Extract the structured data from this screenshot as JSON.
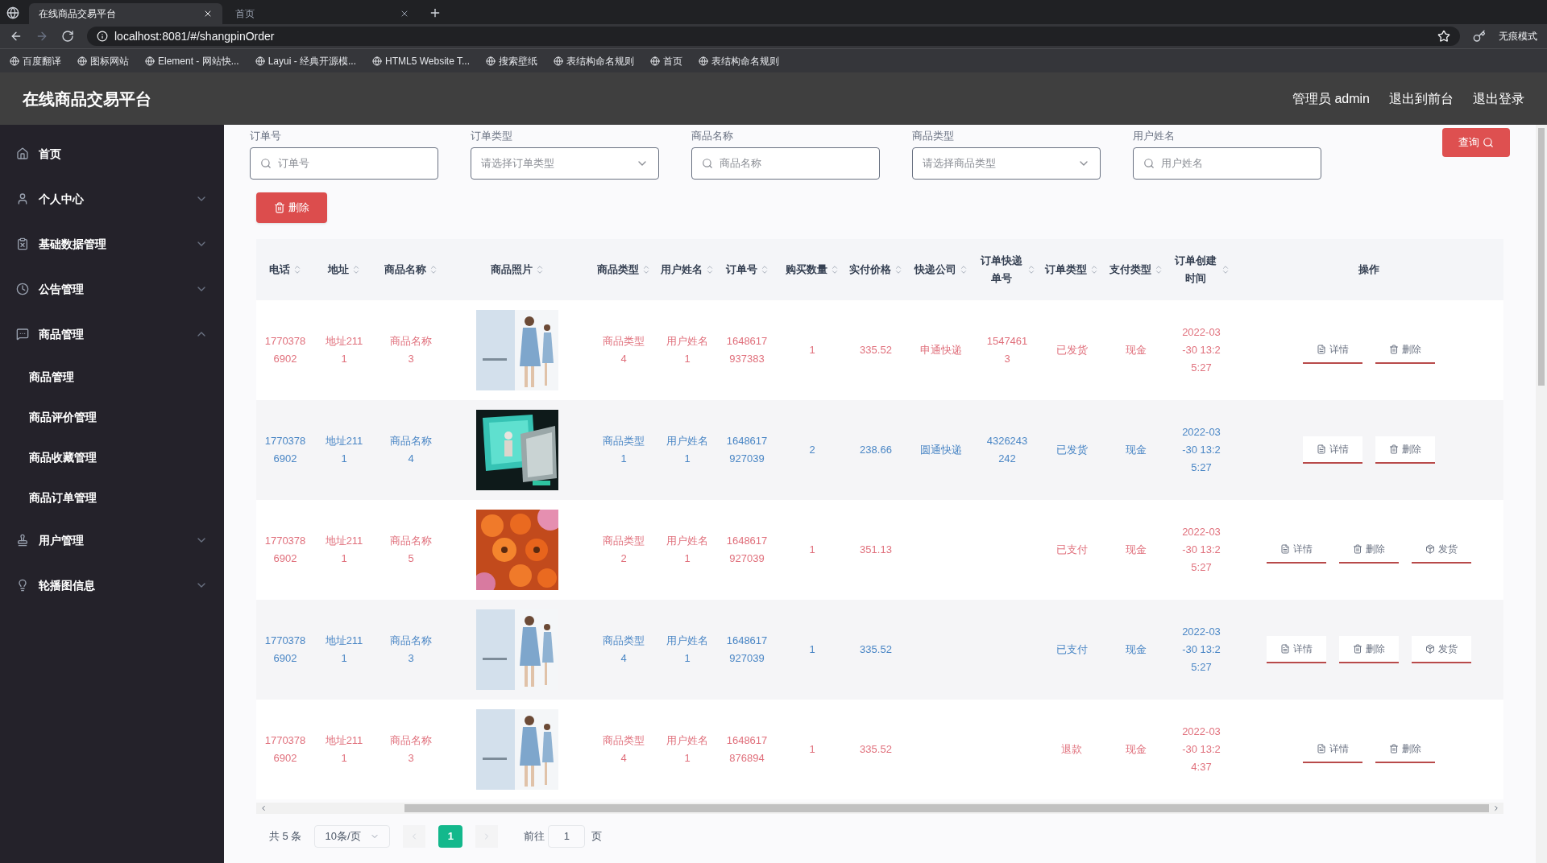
{
  "browser": {
    "tabs": [
      {
        "title": "在线商品交易平台",
        "selected": true
      },
      {
        "title": "首页",
        "selected": false
      }
    ],
    "address": "localhost:8081/#/shangpinOrder",
    "profile": "无痕模式",
    "bookmarks": [
      "百度翻译",
      "图标网站",
      "Element - 网站快...",
      "Layui - 经典开源模...",
      "HTML5 Website T...",
      "搜索壁纸",
      "表结构命名规则",
      "首页",
      "表结构命名规则"
    ]
  },
  "header": {
    "title": "在线商品交易平台",
    "links": [
      "管理员 admin",
      "退出到前台",
      "退出登录"
    ]
  },
  "sidebar": {
    "items": [
      {
        "label": "首页",
        "kind": "home"
      },
      {
        "label": "个人中心",
        "kind": "user",
        "expanded": false
      },
      {
        "label": "基础数据管理",
        "kind": "clipboard",
        "expanded": false
      },
      {
        "label": "公告管理",
        "kind": "clock",
        "expanded": false
      },
      {
        "label": "商品管理",
        "kind": "chat",
        "expanded": true,
        "children": [
          {
            "label": "商品管理"
          },
          {
            "label": "商品评价管理"
          },
          {
            "label": "商品收藏管理"
          },
          {
            "label": "商品订单管理"
          }
        ]
      },
      {
        "label": "用户管理",
        "kind": "stamp",
        "expanded": false
      },
      {
        "label": "轮播图信息",
        "kind": "bulb",
        "expanded": false
      }
    ]
  },
  "filters": [
    {
      "label": "订单号",
      "kind": "input",
      "placeholder": "订单号"
    },
    {
      "label": "订单类型",
      "kind": "select",
      "placeholder": "请选择订单类型"
    },
    {
      "label": "商品名称",
      "kind": "input",
      "placeholder": "商品名称"
    },
    {
      "label": "商品类型",
      "kind": "select",
      "placeholder": "请选择商品类型"
    },
    {
      "label": "用户姓名",
      "kind": "input",
      "placeholder": "用户姓名"
    }
  ],
  "search_button": "查询",
  "delete_button": "删除",
  "table": {
    "columns": [
      {
        "label": "电话",
        "sortable": true
      },
      {
        "label": "地址",
        "sortable": true
      },
      {
        "label": "商品名称",
        "sortable": true
      },
      {
        "label": "商品照片",
        "sortable": true
      },
      {
        "label": "商品类型",
        "sortable": true
      },
      {
        "label": "用户姓名",
        "sortable": true
      },
      {
        "label": "订单号",
        "sortable": true
      },
      {
        "label": "购买数量",
        "sortable": true
      },
      {
        "label": "实付价格",
        "sortable": true
      },
      {
        "label": "快递公司",
        "sortable": true
      },
      {
        "label": "订单快递单号",
        "sortable": true
      },
      {
        "label": "订单类型",
        "sortable": true
      },
      {
        "label": "支付类型",
        "sortable": true
      },
      {
        "label": "订单创建时间",
        "sortable": true
      },
      {
        "label": "操作",
        "sortable": false
      }
    ],
    "rows": [
      {
        "phone": "17703786902",
        "address": "地址2111",
        "product_name": "商品名称3",
        "photo": {
          "kind": "picture"
        },
        "product_type": "商品类型4",
        "user_name": "用户姓名1",
        "order_no": "1648617937383",
        "quantity": "1",
        "paid_price": "335.52",
        "courier": "申通快递",
        "tracking_no": "15474613",
        "order_type": "已发货",
        "payment_type": "现金",
        "created_at": "2022-03-30 13:25:27",
        "actions": [
          {
            "label": "详情",
            "kind": "detail"
          },
          {
            "label": "删除",
            "kind": "delete"
          }
        ]
      },
      {
        "phone": "17703786902",
        "address": "地址2111",
        "product_name": "商品名称4",
        "photo": {
          "kind": "picture"
        },
        "product_type": "商品类型1",
        "user_name": "用户姓名1",
        "order_no": "1648617927039",
        "quantity": "2",
        "paid_price": "238.66",
        "courier": "圆通快递",
        "tracking_no": "4326243242",
        "order_type": "已发货",
        "payment_type": "现金",
        "created_at": "2022-03-30 13:25:27",
        "actions": [
          {
            "label": "详情",
            "kind": "detail"
          },
          {
            "label": "删除",
            "kind": "delete"
          }
        ]
      },
      {
        "phone": "17703786902",
        "address": "地址2111",
        "product_name": "商品名称5",
        "photo": {
          "kind": "picture"
        },
        "product_type": "商品类型2",
        "user_name": "用户姓名1",
        "order_no": "1648617927039",
        "quantity": "1",
        "paid_price": "351.13",
        "order_type": "已支付",
        "payment_type": "现金",
        "created_at": "2022-03-30 13:25:27",
        "actions": [
          {
            "label": "详情",
            "kind": "detail"
          },
          {
            "label": "删除",
            "kind": "delete"
          },
          {
            "label": "发货",
            "kind": "ship"
          }
        ]
      },
      {
        "phone": "17703786902",
        "address": "地址2111",
        "product_name": "商品名称3",
        "photo": {
          "kind": "picture"
        },
        "product_type": "商品类型4",
        "user_name": "用户姓名1",
        "order_no": "1648617927039",
        "quantity": "1",
        "paid_price": "335.52",
        "order_type": "已支付",
        "payment_type": "现金",
        "created_at": "2022-03-30 13:25:27",
        "actions": [
          {
            "label": "详情",
            "kind": "detail"
          },
          {
            "label": "删除",
            "kind": "delete"
          },
          {
            "label": "发货",
            "kind": "ship"
          }
        ]
      },
      {
        "phone": "17703786902",
        "address": "地址2111",
        "product_name": "商品名称3",
        "photo": {
          "kind": "picture"
        },
        "product_type": "商品类型4",
        "user_name": "用户姓名1",
        "order_no": "1648617876894",
        "quantity": "1",
        "paid_price": "335.52",
        "order_type": "退款",
        "payment_type": "现金",
        "created_at": "2022-03-30 13:24:37",
        "actions": [
          {
            "label": "详情",
            "kind": "detail"
          },
          {
            "label": "删除",
            "kind": "delete"
          }
        ]
      }
    ]
  },
  "pagination": {
    "total": "共 5 条",
    "page_size": "10条/页",
    "pages": [
      {
        "label": "1",
        "selected": true
      }
    ],
    "goto_label": "前往",
    "goto_value": "1",
    "goto_suffix": "页"
  }
}
